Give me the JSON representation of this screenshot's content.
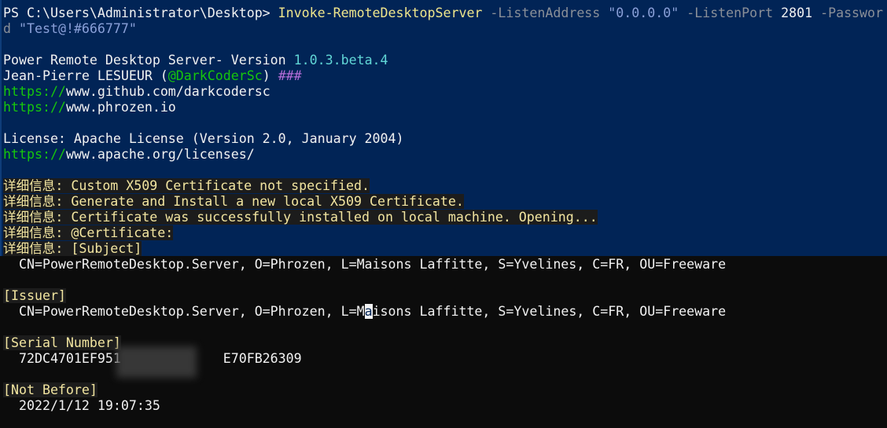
{
  "terminal": {
    "cmd": {
      "prompt": "PS C:\\Users\\Administrator\\Desktop>",
      "command": "Invoke-RemoteDesktopServer",
      "param1": "-ListenAddress",
      "value1": "\"0.0.0.0\"",
      "param2": "-ListenPort",
      "value2": "2801",
      "param3_part1": "-Passwor",
      "param3_part2": "d",
      "value3": "\"Test@!#666777\""
    },
    "banner": {
      "title_label": "Power Remote Desktop Server- Version",
      "version": "1.0.3.beta.4",
      "author_name": "Jean-Pierre LESUEUR (",
      "author_handle": "@DarkCoderSc",
      "author_close": ")",
      "author_suffix": "###",
      "url1_scheme": "https://",
      "url1_rest": "www.github.com/darkcodersc",
      "url2_scheme": "https://",
      "url2_rest": "www.phrozen.io",
      "license_text": "License: Apache License (Version 2.0, January 2004)",
      "url3_scheme": "https://",
      "url3_rest": "www.apache.org/licenses/"
    },
    "verbose": [
      "详细信息: Custom X509 Certificate not specified.",
      "详细信息: Generate and Install a new local X509 Certificate.",
      "详细信息: Certificate was successfully installed on local machine. Opening...",
      "详细信息: @Certificate:",
      "详细信息: [Subject]"
    ],
    "cert": {
      "subject_value": "  CN=PowerRemoteDesktop.Server, O=Phrozen, L=Maisons Laffitte, S=Yvelines, C=FR, OU=Freeware",
      "issuer_header": "[Issuer]",
      "issuer_value_before": "  CN=PowerRemoteDesktop.Server, O=Phrozen, L=M",
      "issuer_value_cursor": "a",
      "issuer_value_after": "isons Laffitte, S=Yvelines, C=FR, OU=Freeware",
      "serial_header": "[Serial Number]",
      "serial_value": "  72DC4701EF951             E70FB26309",
      "notbefore_header": "[Not Before]",
      "notbefore_value": "  2022/1/12 19:07:35"
    }
  }
}
